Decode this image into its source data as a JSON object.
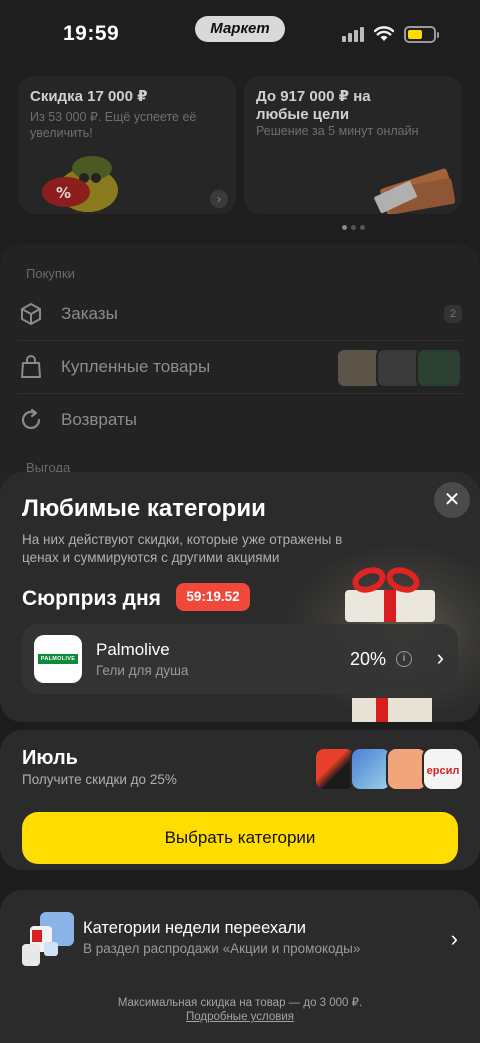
{
  "status_bar": {
    "time": "19:59",
    "app_badge": "Маркет"
  },
  "promos": [
    {
      "title": "Скидка 17 000 ₽",
      "subtitle": "Из 53 000 ₽. Ещё успеете её увеличить!"
    },
    {
      "title": "До 917 000 ₽ на любые цели",
      "subtitle": "Решение за 5 минут онлайн"
    }
  ],
  "purchases": {
    "heading": "Покупки",
    "items": [
      {
        "label": "Заказы",
        "count": "2",
        "icon": "box-icon"
      },
      {
        "label": "Купленные товары",
        "icon": "bag-icon"
      },
      {
        "label": "Возвраты",
        "icon": "return-icon"
      }
    ],
    "next_heading": "Выгода"
  },
  "sheet": {
    "title": "Любимые категории",
    "subtitle": "На них действуют скидки, которые уже отражены в ценах и суммируются с другими акциями",
    "surprise": {
      "label": "Сюрприз дня",
      "timer": "59:19.52",
      "brand": "Palmolive",
      "brand_logo_text": "PALMOLIVE",
      "category": "Гели для душа",
      "discount": "20%"
    },
    "month": {
      "title": "Июль",
      "subtitle": "Получите скидки до 25%",
      "cta": "Выбрать категории",
      "app_icon_text": "ерсил"
    },
    "moved": {
      "title": "Категории недели переехали",
      "subtitle": "В раздел распродажи «Акции и промокоды»"
    },
    "footer_note": "Максимальная скидка на товар — до 3 000 ₽.",
    "footer_link": "Подробные условия"
  },
  "colors": {
    "accent_yellow": "#ffdd00",
    "timer_red": "#f0483a",
    "brand_green": "#0d8a3a"
  }
}
